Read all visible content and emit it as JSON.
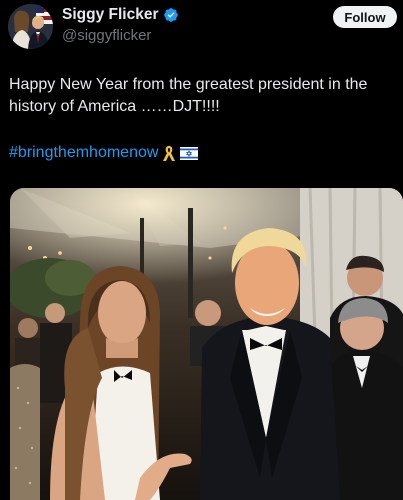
{
  "author": {
    "display_name": "Siggy Flicker",
    "handle": "@siggyflicker",
    "verified": true,
    "avatar_icon": "profile-photo",
    "verified_icon": "verified-badge-icon"
  },
  "follow_label": "Follow",
  "post": {
    "text": "Happy New Year from the greatest president in the history of America ……DJT!!!!",
    "hashtag": "#bringthemhomenow",
    "hashtag_emojis": [
      "yellow-ribbon-icon",
      "israel-flag-icon"
    ]
  },
  "media": {
    "type": "photo",
    "description_icon": "attached-photo"
  },
  "colors": {
    "background": "#000000",
    "text": "#e7e9ea",
    "secondary": "#71767b",
    "link": "#1d9bf0",
    "verified": "#1d9bf0",
    "button_bg": "#eff3f4"
  }
}
